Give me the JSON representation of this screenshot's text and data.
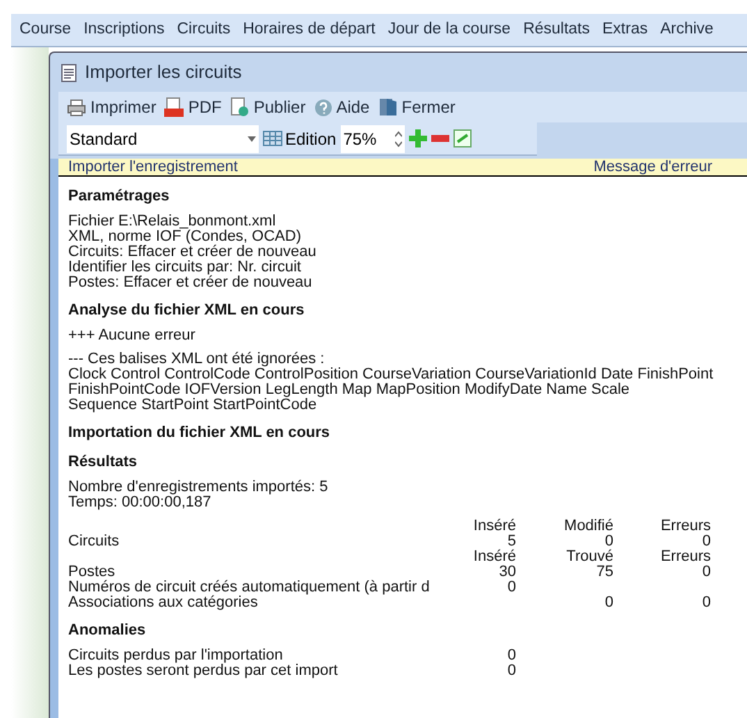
{
  "menu": [
    {
      "label": "Course"
    },
    {
      "label": "Inscriptions"
    },
    {
      "label": "Circuits"
    },
    {
      "label": "Horaires de départ"
    },
    {
      "label": "Jour de la course"
    },
    {
      "label": "Résultats"
    },
    {
      "label": "Extras"
    },
    {
      "label": "Archive"
    }
  ],
  "window": {
    "title": "Importer les circuits"
  },
  "toolbar": [
    {
      "kind": "print",
      "label": "Imprimer"
    },
    {
      "kind": "pdf",
      "label": "PDF"
    },
    {
      "kind": "publish",
      "label": "Publier"
    },
    {
      "kind": "help",
      "label": "Aide"
    },
    {
      "kind": "close",
      "label": "Fermer"
    }
  ],
  "view_toolbar": {
    "layout": "Standard",
    "edition": "Edition",
    "zoom": "75%"
  },
  "report": {
    "header_left": "Importer l'enregistrement",
    "header_right": "Message d'erreur",
    "sections": [
      {
        "heading": "Paramétrages",
        "paragraphs": [
          [
            "Fichier E:\\Relais_bonmont.xml",
            "XML, norme IOF (Condes, OCAD)",
            "Circuits: Effacer et créer de nouveau",
            "Identifier les circuits par: Nr. circuit",
            "Postes: Effacer et créer de nouveau"
          ]
        ]
      },
      {
        "heading": "Analyse du fichier XML en cours",
        "paragraphs": [
          [
            "+++ Aucune erreur"
          ],
          [
            "--- Ces balises XML ont été ignorées :",
            "Clock Control ControlCode ControlPosition CourseVariation CourseVariationId Date FinishPoint",
            "FinishPointCode IOFVersion LegLength Map MapPosition ModifyDate Name Scale",
            "Sequence StartPoint StartPointCode"
          ]
        ]
      },
      {
        "heading": "Importation du fichier XML en cours"
      },
      {
        "heading": "Résultats",
        "paragraphs": [
          [
            "Nombre d'enregistrements importés: 5",
            "Temps: 00:00:00,187"
          ]
        ],
        "table": [
          {
            "headers": [
              "Inséré",
              "Modifié",
              "Erreurs"
            ],
            "label": "Circuits",
            "column_1": "5",
            "column_2": "0",
            "column_3": "0"
          },
          {
            "headers": [
              "Inséré",
              "Trouvé",
              "Erreurs"
            ],
            "label": "Postes",
            "column_1": "30",
            "column_2": "75",
            "column_3": "0"
          },
          {
            "label": "Numéros de circuit créés automatiquement (à partir d",
            "column_1": "0"
          },
          {
            "label": "Associations aux catégories",
            "column_2": "0",
            "column_3": "0"
          }
        ]
      },
      {
        "heading": "Anomalies",
        "table": [
          {
            "label": "Circuits perdus par l'importation",
            "column_1": "0"
          },
          {
            "label": "Les postes seront perdus par cet import",
            "column_1": "0"
          }
        ]
      }
    ]
  }
}
